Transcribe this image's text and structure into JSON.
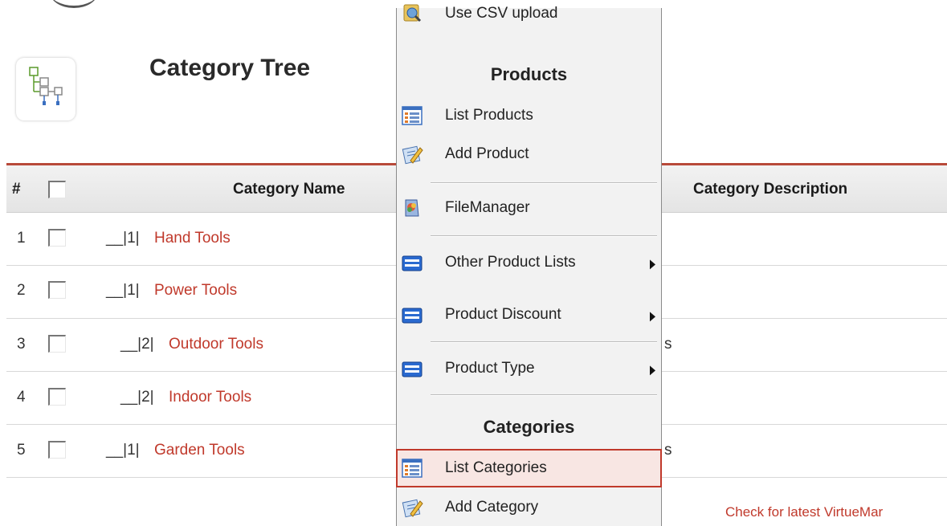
{
  "header": {
    "title": "Category Tree"
  },
  "table": {
    "columns": {
      "num": "#",
      "name": "Category Name",
      "description": "Category Description"
    },
    "rows": [
      {
        "num": "1",
        "prefix": "__|1|",
        "name": "Hand Tools",
        "desc_stub": ""
      },
      {
        "num": "2",
        "prefix": "__|1|",
        "name": "Power Tools",
        "desc_stub": ""
      },
      {
        "num": "3",
        "prefix": "__|2|",
        "name": "Outdoor Tools",
        "desc_stub": "s"
      },
      {
        "num": "4",
        "prefix": "__|2|",
        "name": "Indoor Tools",
        "desc_stub": ""
      },
      {
        "num": "5",
        "prefix": "__|1|",
        "name": "Garden Tools",
        "desc_stub": "s"
      }
    ]
  },
  "menu": {
    "top_item": {
      "label": "Use CSV upload",
      "icon": "csv-upload-icon"
    },
    "products_heading": "Products",
    "products": [
      {
        "label": "List Products",
        "icon": "list-icon",
        "submenu": false
      },
      {
        "label": "Add Product",
        "icon": "add-edit-icon",
        "submenu": false
      },
      {
        "label": "FileManager",
        "icon": "file-manager-icon",
        "submenu": false
      },
      {
        "label": "Other Product Lists",
        "icon": "folder-icon",
        "submenu": true
      },
      {
        "label": "Product Discount",
        "icon": "folder-icon",
        "submenu": true
      },
      {
        "label": "Product Type",
        "icon": "folder-icon",
        "submenu": true
      }
    ],
    "categories_heading": "Categories",
    "categories": [
      {
        "label": "List Categories",
        "icon": "list-icon",
        "active": true
      },
      {
        "label": "Add Category",
        "icon": "add-edit-icon",
        "active": false
      }
    ]
  },
  "footer": {
    "link": "Check for latest VirtueMar"
  },
  "colors": {
    "accent": "#c0392b",
    "table_rule": "#b84a3a"
  }
}
